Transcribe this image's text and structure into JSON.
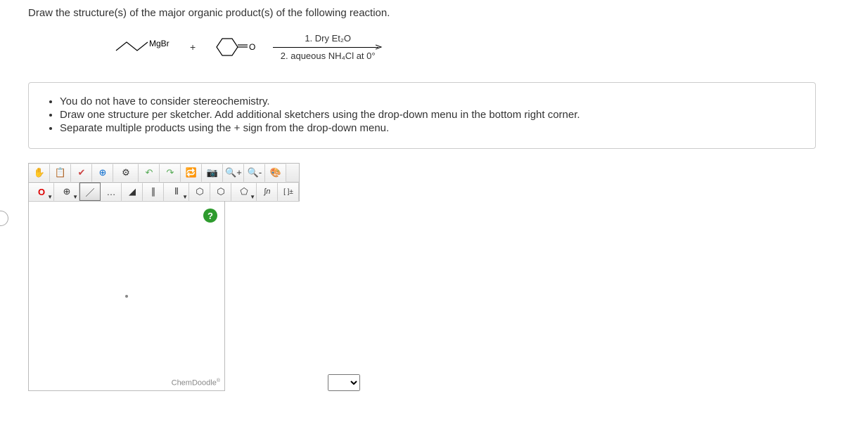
{
  "question": "Draw the structure(s) of the major organic product(s) of the following reaction.",
  "reaction": {
    "reagent1_label": "MgBr",
    "plus": "+",
    "ketone_label": "O",
    "condition1": "1. Dry Et₂O",
    "condition2": "2. aqueous NH₄Cl at 0°"
  },
  "instructions": [
    "You do not have to consider stereochemistry.",
    "Draw one structure per sketcher. Add additional sketchers using the drop-down menu in the bottom right corner.",
    "Separate multiple products using the + sign from the drop-down menu."
  ],
  "toolbar1": {
    "hand": "✋",
    "paste": "📋",
    "clear": "✔",
    "center": "⊕",
    "clean": "⚙",
    "undo": "↶",
    "redo": "↷",
    "flip": "🔁",
    "copyimg": "📷",
    "zoomin": "🔍+",
    "zoomout": "🔍-",
    "settings": "🎨"
  },
  "toolbar2": {
    "element": "O",
    "charge": "⊕",
    "bond_single": "／",
    "bond_recessed": "…",
    "bond_wedge": "◢",
    "bond_double": "∥",
    "bond_triple": "⫴",
    "ring6": "⬡",
    "ring6b": "⬡",
    "ring5": "⬠",
    "chain": "∫n",
    "bracket": "[ ]±"
  },
  "canvas": {
    "help": "?",
    "brand": "ChemDoodle",
    "brand_sup": "®"
  }
}
